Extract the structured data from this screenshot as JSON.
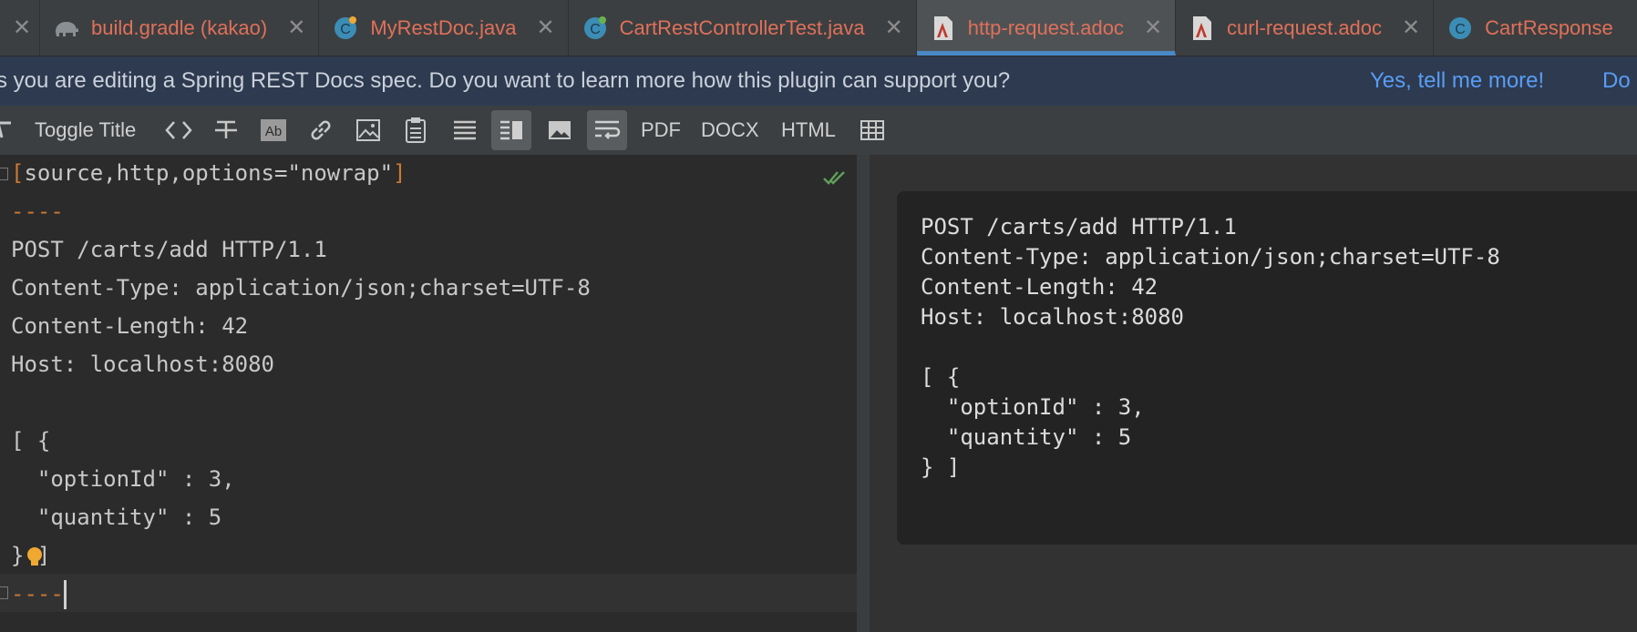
{
  "tabs": [
    {
      "label": "build.gradle (kakao)",
      "icon": "gradle-elephant-icon"
    },
    {
      "label": "MyRestDoc.java",
      "icon": "java-class-icon"
    },
    {
      "label": "CartRestControllerTest.java",
      "icon": "java-class-icon"
    },
    {
      "label": "http-request.adoc",
      "icon": "asciidoc-file-icon",
      "active": true
    },
    {
      "label": "curl-request.adoc",
      "icon": "asciidoc-file-icon"
    },
    {
      "label": "CartResponse",
      "icon": "java-class-icon"
    }
  ],
  "notification": {
    "message": "s you are editing a Spring REST Docs spec. Do you want to learn more how this plugin can support you?",
    "action_yes": "Yes, tell me more!",
    "action_other": "Do"
  },
  "toolbar": {
    "toggle_title": "Toggle Title",
    "pdf": "PDF",
    "docx": "DOCX",
    "html": "HTML"
  },
  "editor": {
    "lines": [
      {
        "open": "[",
        "text": "source,http,options=\"nowrap\"",
        "close": "]"
      },
      "----",
      "POST /carts/add HTTP/1.1",
      "Content-Type: application/json;charset=UTF-8",
      "Content-Length: 42",
      "Host: localhost:8080",
      "",
      "[ {",
      "  \"optionId\" : 3,",
      "  \"quantity\" : 5",
      "} ]",
      "----"
    ]
  },
  "preview": {
    "lines": [
      "POST /carts/add HTTP/1.1",
      "Content-Type: application/json;charset=UTF-8",
      "Content-Length: 42",
      "Host: localhost:8080",
      "",
      "[ {",
      "  \"optionId\" : 3,",
      "  \"quantity\" : 5",
      "} ]"
    ]
  },
  "colors": {
    "tab_text": "#e0705a",
    "active_underline": "#4a88c7",
    "link": "#589df6",
    "keyword_orange": "#cc7832",
    "notice_bg": "#2e3a4f"
  }
}
